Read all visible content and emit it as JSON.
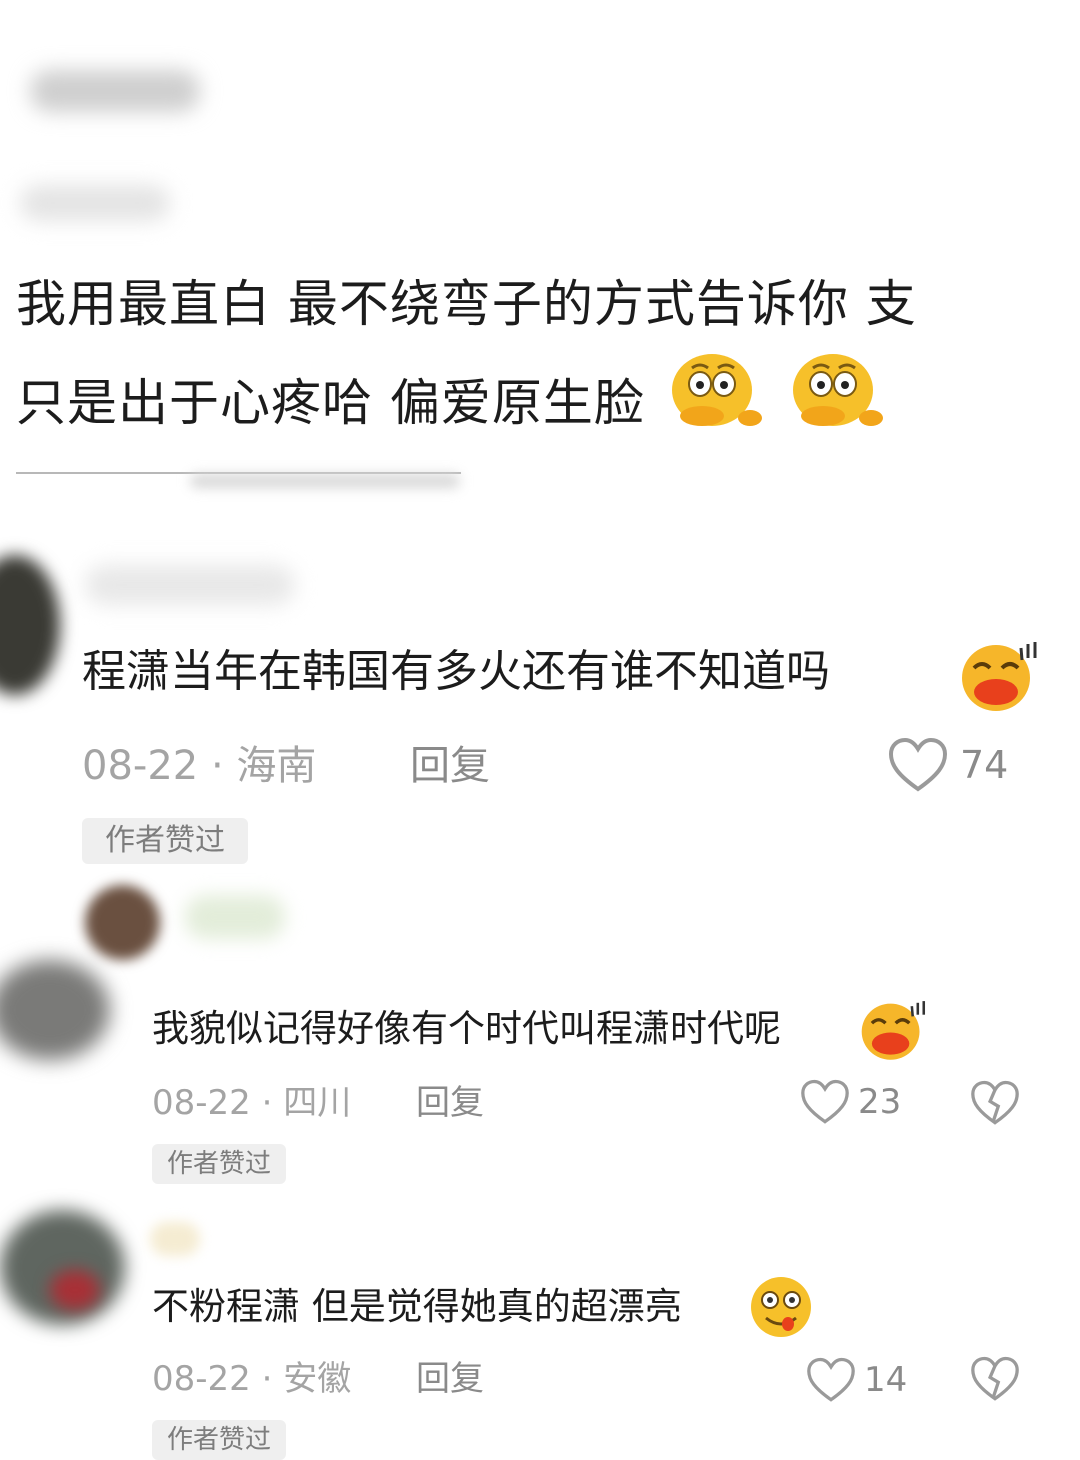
{
  "post": {
    "line1": "我用最直白 最不绕弯子的方式告诉你 支",
    "line2": "只是出于心疼哈 偏爱原生脸"
  },
  "comments": [
    {
      "text": "程潇当年在韩国有多火还有谁不知道吗",
      "date_loc": "08-22 · 海南",
      "reply": "回复",
      "likes": "74",
      "badge": "作者赞过"
    },
    {
      "text": "我貌似记得好像有个时代叫程潇时代呢",
      "date_loc": "08-22 · 四川",
      "reply": "回复",
      "likes": "23",
      "badge": "作者赞过"
    },
    {
      "text": "不粉程潇 但是觉得她真的超漂亮",
      "date_loc": "08-22 · 安徽",
      "reply": "回复",
      "likes": "14",
      "badge": "作者赞过"
    }
  ],
  "icons": [
    "thinking-emoji-icon",
    "laughing-emoji-icon",
    "drooling-emoji-icon",
    "heart-icon",
    "broken-heart-icon"
  ],
  "colors": {
    "text": "#1c1c1c",
    "meta": "#a4a4a4",
    "badge_bg": "#efefef",
    "emoji": "#f6c02a"
  }
}
